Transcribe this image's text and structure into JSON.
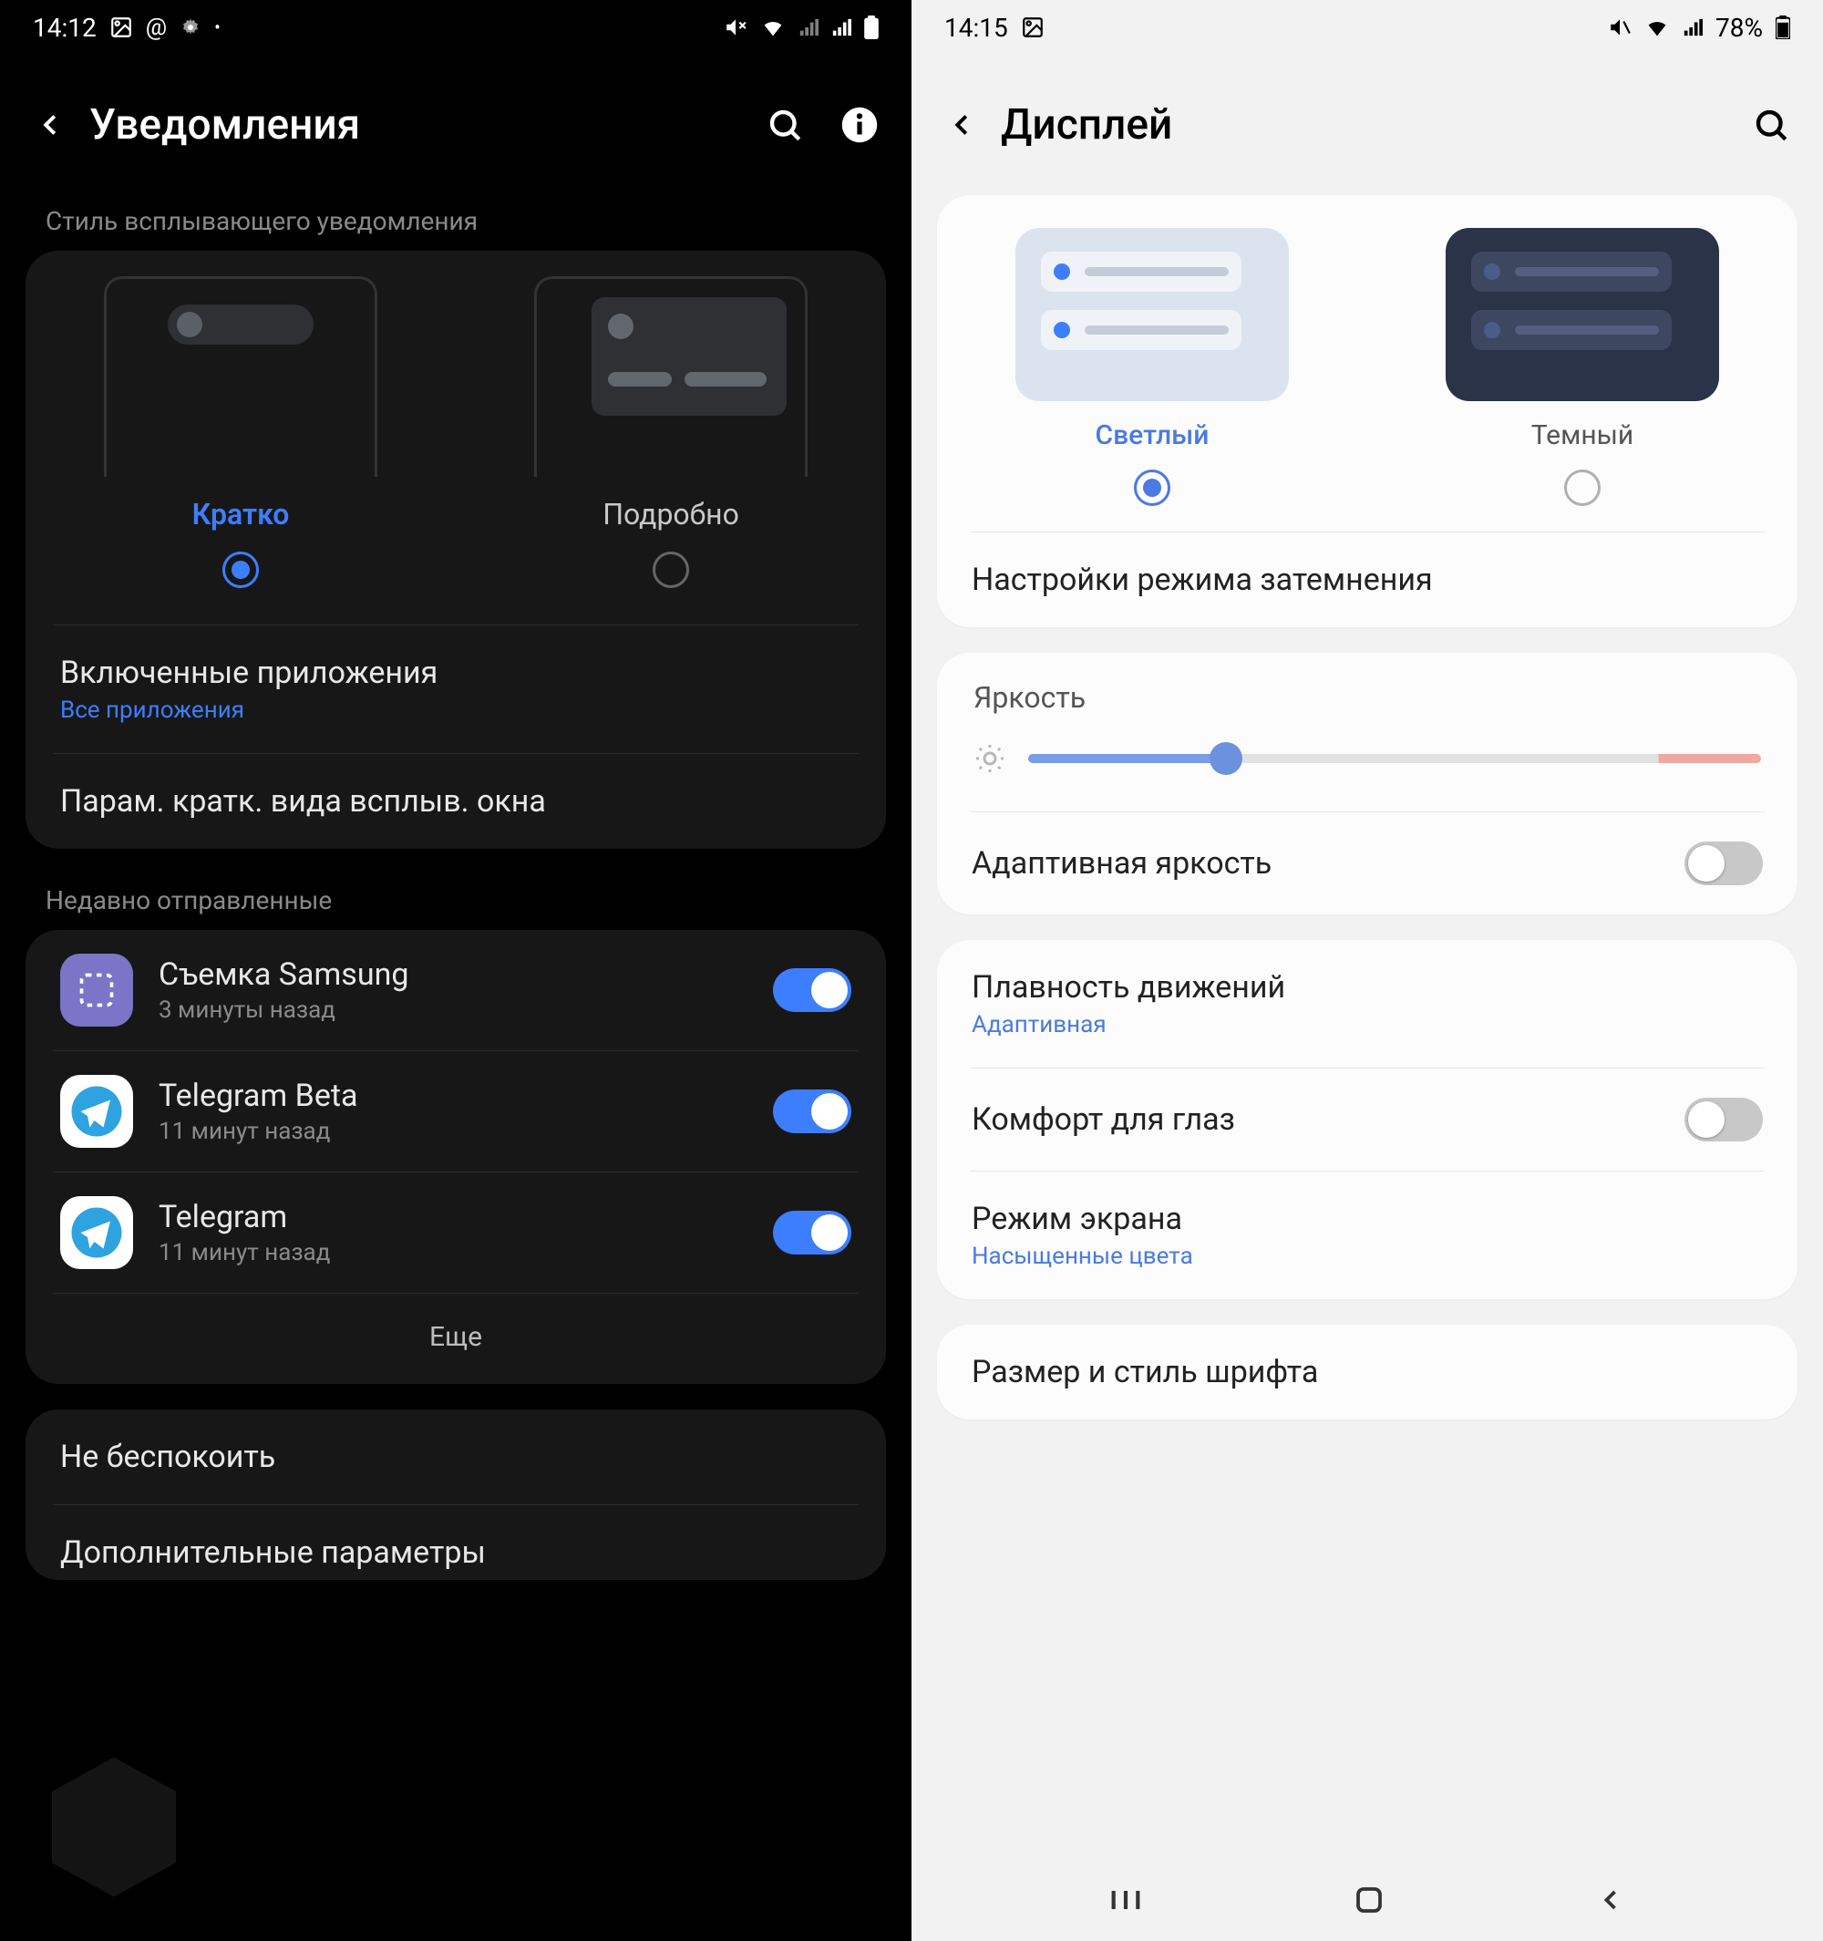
{
  "left": {
    "status": {
      "time": "14:12",
      "icons": "🖼 @ ⚙ •",
      "right": "🔕 📶₊ 📶 📶 🔋"
    },
    "header": {
      "title": "Уведомления"
    },
    "popup_section_label": "Стиль всплывающего уведомления",
    "styles": {
      "brief": "Кратко",
      "detail": "Подробно",
      "selected": "brief"
    },
    "included": {
      "title": "Включенные приложения",
      "sub": "Все приложения"
    },
    "brief_params": "Парам. кратк. вида всплыв. окна",
    "recent_label": "Недавно отправленные",
    "apps": [
      {
        "name": "Съемка Samsung",
        "time": "3 минуты назад",
        "icon": "samsung",
        "on": true
      },
      {
        "name": "Telegram Beta",
        "time": "11 минут назад",
        "icon": "tg",
        "on": true
      },
      {
        "name": "Telegram",
        "time": "11 минут назад",
        "icon": "tg",
        "on": true
      }
    ],
    "more": "Еще",
    "dnd": "Не беспокоить",
    "advanced": "Дополнительные параметры"
  },
  "right": {
    "status": {
      "time": "14:15",
      "icons": "🖼",
      "battery": "78%"
    },
    "header": {
      "title": "Дисплей"
    },
    "themes": {
      "light": "Светлый",
      "dark": "Темный",
      "selected": "light"
    },
    "dark_settings": "Настройки режима затемнения",
    "brightness_label": "Яркость",
    "brightness_value": 27,
    "adaptive_brightness": {
      "title": "Адаптивная яркость",
      "on": false
    },
    "motion": {
      "title": "Плавность движений",
      "sub": "Адаптивная"
    },
    "eye_comfort": {
      "title": "Комфорт для глаз",
      "on": false
    },
    "screen_mode": {
      "title": "Режим экрана",
      "sub": "Насыщенные цвета"
    },
    "font": {
      "title": "Размер и стиль шрифта"
    }
  }
}
